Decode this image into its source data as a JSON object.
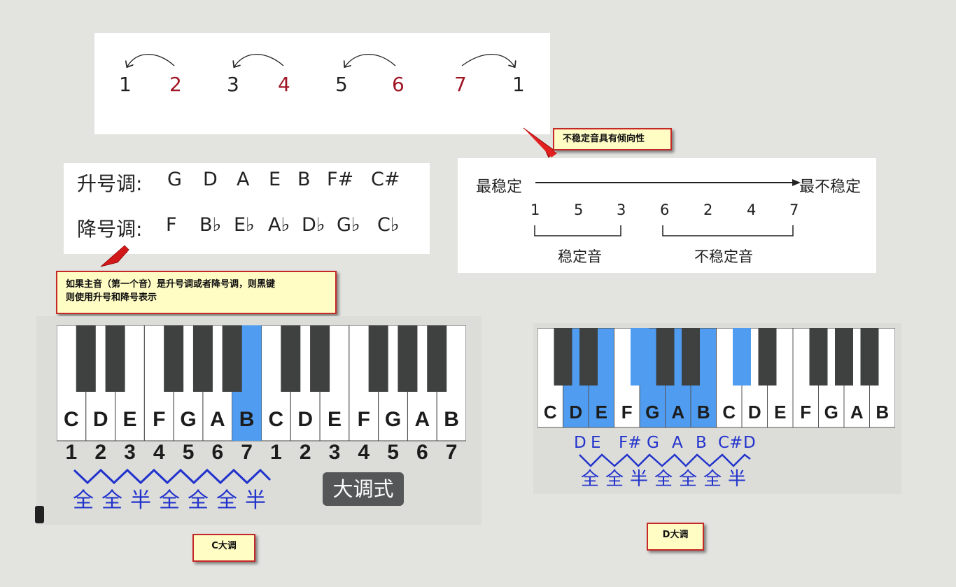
{
  "top_panel": {
    "numbers": [
      {
        "text": "1",
        "red": false
      },
      {
        "text": "2",
        "red": true
      },
      {
        "text": "3",
        "red": false
      },
      {
        "text": "4",
        "red": true
      },
      {
        "text": "5",
        "red": false
      },
      {
        "text": "6",
        "red": true
      },
      {
        "text": "7",
        "red": true
      },
      {
        "text": "1",
        "red": false
      }
    ]
  },
  "callout_tendency": "不稳定音具有倾向性",
  "keys_panel": {
    "sharp_label": "升号调:",
    "sharp_keys": [
      "G",
      "D",
      "A",
      "E",
      "B",
      "F#",
      "C#"
    ],
    "flat_label": "降号调:",
    "flat_keys": [
      "F",
      "B♭",
      "E♭",
      "A♭",
      "D♭",
      "G♭",
      "C♭"
    ]
  },
  "stability": {
    "left_label": "最稳定",
    "right_label": "最不稳定",
    "stable_numbers": [
      "1",
      "5",
      "3"
    ],
    "unstable_numbers": [
      "6",
      "2",
      "4",
      "7"
    ],
    "stable_caption": "稳定音",
    "unstable_caption": "不稳定音"
  },
  "callout_accidentals": {
    "line1": "如果主音（第一个音）是升号调或者降号调，则黑键",
    "line2": "则使用升号和降号表示"
  },
  "c_major": {
    "white_labels": [
      "C",
      "D",
      "E",
      "F",
      "G",
      "A",
      "B",
      "C",
      "D",
      "E",
      "F",
      "G",
      "A",
      "B"
    ],
    "highlight_index": 6,
    "degrees": [
      "1",
      "2",
      "3",
      "4",
      "5",
      "6",
      "7",
      "1",
      "2",
      "3",
      "4",
      "5",
      "6",
      "7"
    ],
    "steps": [
      "全",
      "全",
      "半",
      "全",
      "全",
      "全",
      "半"
    ],
    "badge": "大调式",
    "caption": "C大调"
  },
  "d_major": {
    "white_labels": [
      "C",
      "D",
      "E",
      "F",
      "G",
      "A",
      "B",
      "C",
      "D",
      "E",
      "F",
      "G",
      "A",
      "B"
    ],
    "scale_notes": [
      "D",
      "E",
      "F#",
      "G",
      "A",
      "B",
      "C#",
      "D"
    ],
    "steps": [
      "全",
      "全",
      "半",
      "全",
      "全",
      "全",
      "半"
    ],
    "caption": "D大调"
  },
  "colors": {
    "highlight_blue": "#4f9cf0",
    "black_key": "#3f4140",
    "red_digit": "#a01525",
    "note_blue": "#2233cc",
    "callout_bg": "#fffcc4",
    "callout_border": "#c62828"
  }
}
